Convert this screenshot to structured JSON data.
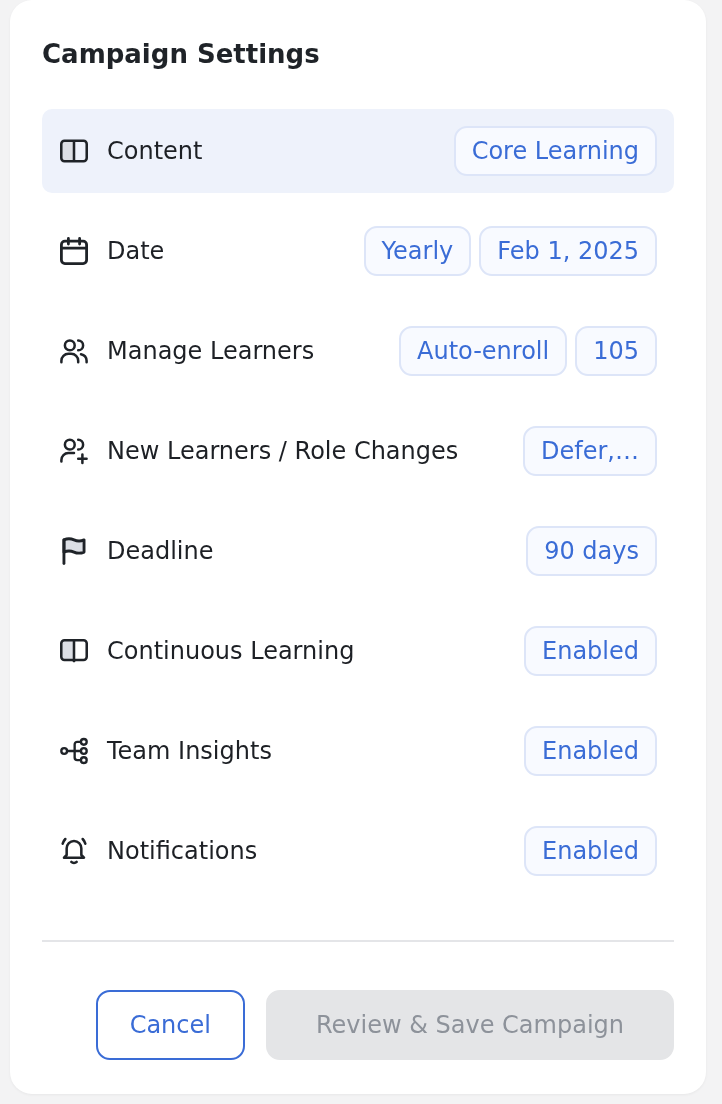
{
  "panel": {
    "title": "Campaign Settings"
  },
  "settings": [
    {
      "label": "Content",
      "selected": true,
      "values": [
        "Core Learning"
      ]
    },
    {
      "label": "Date",
      "selected": false,
      "values": [
        "Yearly",
        "Feb 1, 2025"
      ]
    },
    {
      "label": "Manage Learners",
      "selected": false,
      "values": [
        "Auto-enroll",
        "105"
      ]
    },
    {
      "label": "New Learners / Role Changes",
      "selected": false,
      "values": [
        "Defer,…"
      ]
    },
    {
      "label": "Deadline",
      "selected": false,
      "values": [
        "90 days"
      ]
    },
    {
      "label": "Continuous Learning",
      "selected": false,
      "values": [
        "Enabled"
      ]
    },
    {
      "label": "Team Insights",
      "selected": false,
      "values": [
        "Enabled"
      ]
    },
    {
      "label": "Notifications",
      "selected": false,
      "values": [
        "Enabled"
      ]
    }
  ],
  "actions": [
    {
      "label": "Cancel",
      "kind": "secondary",
      "disabled": false
    },
    {
      "label": "Review & Save Campaign",
      "kind": "primary",
      "disabled": true
    }
  ]
}
